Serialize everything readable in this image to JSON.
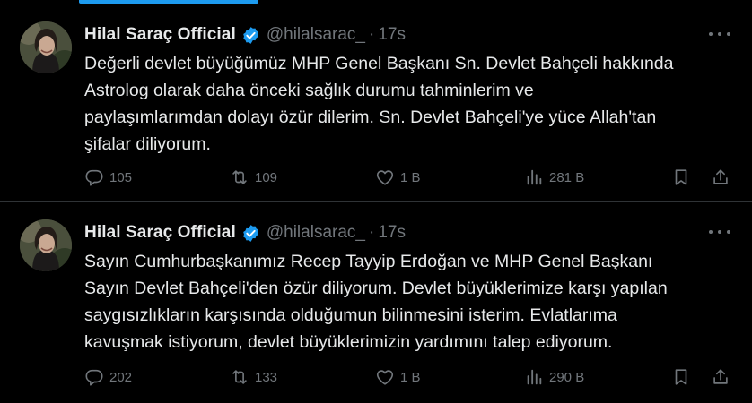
{
  "tweets": [
    {
      "author_name": "Hilal Saraç Official",
      "handle": "@hilalsarac_",
      "separator": "·",
      "time": "17s",
      "text": "Değerli devlet büyüğümüz MHP Genel Başkanı Sn. Devlet Bahçeli hakkında\nAstrolog olarak daha önceki sağlık durumu tahminlerim ve\npaylaşımlarımdan dolayı özür dilerim. Sn. Devlet Bahçeli'ye yüce Allah'tan\nşifalar diliyorum.",
      "replies": "105",
      "retweets": "109",
      "likes": "1 B",
      "views": "281 B"
    },
    {
      "author_name": "Hilal Saraç Official",
      "handle": "@hilalsarac_",
      "separator": "·",
      "time": "17s",
      "text": "Sayın Cumhurbaşkanımız Recep Tayyip Erdoğan ve MHP Genel Başkanı\nSayın Devlet Bahçeli'den özür diliyorum. Devlet büyüklerimize karşı yapılan\nsaygısızlıkların karşısında olduğumun bilinmesini isterim. Evlatlarıma\nkavuşmak istiyorum, devlet büyüklerimizin yardımını talep ediyorum.",
      "replies": "202",
      "retweets": "133",
      "likes": "1 B",
      "views": "290 B"
    }
  ],
  "colors": {
    "background": "#000000",
    "text": "#e7e9ea",
    "muted": "#71767b",
    "verified": "#1d9bf0",
    "divider": "#2f3336"
  },
  "icons": {
    "verified": "verified-badge-icon",
    "more": "more-icon",
    "reply": "reply-icon",
    "retweet": "retweet-icon",
    "like": "like-icon",
    "views": "views-icon",
    "bookmark": "bookmark-icon",
    "share": "share-icon"
  }
}
